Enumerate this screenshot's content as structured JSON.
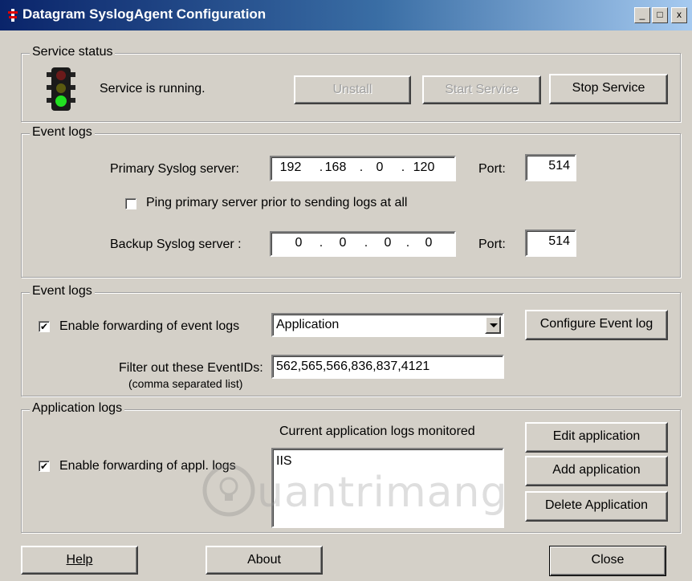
{
  "window": {
    "title": "Datagram SyslogAgent Configuration",
    "minimize_glyph": "_",
    "maximize_glyph": "□",
    "close_glyph": "x"
  },
  "service_status": {
    "legend": "Service status",
    "status_text": "Service is running.",
    "icon": "traffic-light-icon",
    "buttons": {
      "uninstall": "Unstall",
      "start": "Start Service",
      "stop": "Stop Service"
    }
  },
  "event_logs_servers": {
    "legend": "Event logs",
    "primary_label": "Primary Syslog server:",
    "primary_ip": [
      "192",
      "168",
      "0",
      "120"
    ],
    "primary_port_label": "Port:",
    "primary_port": "514",
    "ping_checkbox_label": "Ping primary server prior to sending logs at all",
    "ping_checked": false,
    "backup_label": "Backup Syslog server :",
    "backup_ip": [
      "0",
      "0",
      "0",
      "0"
    ],
    "backup_port_label": "Port:",
    "backup_port": "514",
    "ip_dot": "."
  },
  "event_logs_forwarding": {
    "legend": "Event logs",
    "enable_label": "Enable forwarding of event logs",
    "enable_checked": true,
    "log_select_value": "Application",
    "configure_button": "Configure Event log",
    "filter_label": "Filter out these EventIDs:",
    "filter_sublabel": "(comma separated list)",
    "filter_value": "562,565,566,836,837,4121"
  },
  "application_logs": {
    "legend": "Application logs",
    "list_heading": "Current application logs monitored",
    "enable_label": "Enable forwarding of appl. logs",
    "enable_checked": true,
    "list_items": [
      "IIS"
    ],
    "buttons": {
      "edit": "Edit application",
      "add": "Add application",
      "delete": "Delete Application"
    }
  },
  "footer": {
    "help": "Help",
    "about": "About",
    "close": "Close"
  },
  "watermark": {
    "text": "uantrimang"
  },
  "check_glyph": "✔",
  "colors": {
    "titlebar_start": "#0a246a",
    "titlebar_end": "#a6caf0",
    "face": "#d4d0c8"
  }
}
